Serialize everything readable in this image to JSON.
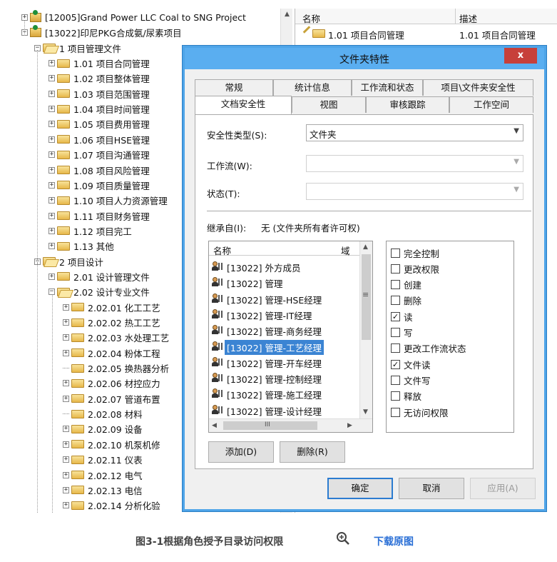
{
  "tree": {
    "nodes": [
      {
        "label": "[12005]Grand Power LLC Coal to SNG Project",
        "kind": "project",
        "expander": "+"
      },
      {
        "label": "[13022]印尼PKG合成氨/尿素项目",
        "kind": "project",
        "expander": "−"
      },
      {
        "label": "1 项目管理文件",
        "kind": "folder-open",
        "expander": "−"
      },
      {
        "label": "1.01 项目合同管理",
        "kind": "folder",
        "expander": "+"
      },
      {
        "label": "1.02 项目整体管理",
        "kind": "folder",
        "expander": "+"
      },
      {
        "label": "1.03 项目范围管理",
        "kind": "folder",
        "expander": "+"
      },
      {
        "label": "1.04 项目时间管理",
        "kind": "folder",
        "expander": "+"
      },
      {
        "label": "1.05 项目费用管理",
        "kind": "folder",
        "expander": "+"
      },
      {
        "label": "1.06 项目HSE管理",
        "kind": "folder",
        "expander": "+"
      },
      {
        "label": "1.07 项目沟通管理",
        "kind": "folder",
        "expander": "+"
      },
      {
        "label": "1.08 项目风险管理",
        "kind": "folder",
        "expander": "+"
      },
      {
        "label": "1.09 项目质量管理",
        "kind": "folder",
        "expander": "+"
      },
      {
        "label": "1.10 项目人力资源管理",
        "kind": "folder",
        "expander": "+"
      },
      {
        "label": "1.11 项目财务管理",
        "kind": "folder",
        "expander": "+"
      },
      {
        "label": "1.12 项目完工",
        "kind": "folder",
        "expander": "+"
      },
      {
        "label": "1.13 其他",
        "kind": "folder",
        "expander": "+"
      },
      {
        "label": "2 项目设计",
        "kind": "folder-open",
        "expander": "−"
      },
      {
        "label": "2.01 设计管理文件",
        "kind": "folder",
        "expander": "+"
      },
      {
        "label": "2.02 设计专业文件",
        "kind": "folder-open",
        "expander": "−"
      },
      {
        "label": "2.02.01 化工工艺",
        "kind": "folder",
        "expander": "+"
      },
      {
        "label": "2.02.02 热工工艺",
        "kind": "folder",
        "expander": "+"
      },
      {
        "label": "2.02.03 水处理工艺",
        "kind": "folder",
        "expander": "+"
      },
      {
        "label": "2.02.04 粉体工程",
        "kind": "folder",
        "expander": "+"
      },
      {
        "label": "2.02.05 换热器分析",
        "kind": "folder",
        "expander": ""
      },
      {
        "label": "2.02.06 材控应力",
        "kind": "folder",
        "expander": "+"
      },
      {
        "label": "2.02.07 管道布置",
        "kind": "folder",
        "expander": "+"
      },
      {
        "label": "2.02.08 材料",
        "kind": "folder",
        "expander": ""
      },
      {
        "label": "2.02.09 设备",
        "kind": "folder",
        "expander": "+"
      },
      {
        "label": "2.02.10 机泵机修",
        "kind": "folder",
        "expander": "+"
      },
      {
        "label": "2.02.11 仪表",
        "kind": "folder",
        "expander": "+"
      },
      {
        "label": "2.02.12 电气",
        "kind": "folder",
        "expander": "+"
      },
      {
        "label": "2.02.13 电信",
        "kind": "folder",
        "expander": "+"
      },
      {
        "label": "2.02.14 分析化验",
        "kind": "folder",
        "expander": "+"
      }
    ]
  },
  "file_list": {
    "col_name": "名称",
    "col_desc": "描述",
    "rows": [
      {
        "name": "1.01 项目合同管理",
        "desc": "1.01 项目合同管理"
      }
    ]
  },
  "dialog": {
    "title": "文件夹特性",
    "close": "x",
    "tabs_row1": [
      "常规",
      "统计信息",
      "工作流和状态",
      "项目\\文件夹安全性"
    ],
    "tabs_row2": [
      "文档安全性",
      "视图",
      "审核跟踪",
      "工作空间"
    ],
    "active_tab": "文档安全性",
    "security_type_label": "安全性类型(S):",
    "security_type_value": "文件夹",
    "workflow_label": "工作流(W):",
    "workflow_value": "",
    "state_label": "状态(T):",
    "state_value": "",
    "inherit_label": "继承自(I):",
    "inherit_value": "无 (文件夹所有者许可权)",
    "list_col_name": "名称",
    "list_col_domain": "域",
    "members": [
      "[13022] 外方成员",
      "[13022] 管理",
      "[13022] 管理-HSE经理",
      "[13022] 管理-IT经理",
      "[13022] 管理-商务经理",
      "[13022] 管理-工艺经理",
      "[13022] 管理-开车经理",
      "[13022] 管理-控制经理",
      "[13022] 管理-施工经理",
      "[13022] 管理-设计经理"
    ],
    "selected_member_index": 5,
    "permissions": [
      {
        "label": "完全控制",
        "checked": false
      },
      {
        "label": "更改权限",
        "checked": false
      },
      {
        "label": "创建",
        "checked": false
      },
      {
        "label": "删除",
        "checked": false
      },
      {
        "label": "读",
        "checked": true
      },
      {
        "label": "写",
        "checked": false
      },
      {
        "label": "更改工作流状态",
        "checked": false
      },
      {
        "label": "文件读",
        "checked": true
      },
      {
        "label": "文件写",
        "checked": false
      },
      {
        "label": "释放",
        "checked": false
      },
      {
        "label": "无访问权限",
        "checked": false
      }
    ],
    "add_button": "添加(D)",
    "remove_button": "删除(R)",
    "ok_button": "确定",
    "cancel_button": "取消",
    "apply_button": "应用(A)",
    "scroll_mid_glyph": "≡",
    "hscroll_grip": "III"
  },
  "caption": {
    "text": "图3-1根据角色授予目录访问权限",
    "download": "下载原图"
  },
  "colors": {
    "dialog_title": "#5aaef0",
    "close_button": "#c7403a",
    "selection": "#3b84d3",
    "link": "#2a6fd6"
  }
}
